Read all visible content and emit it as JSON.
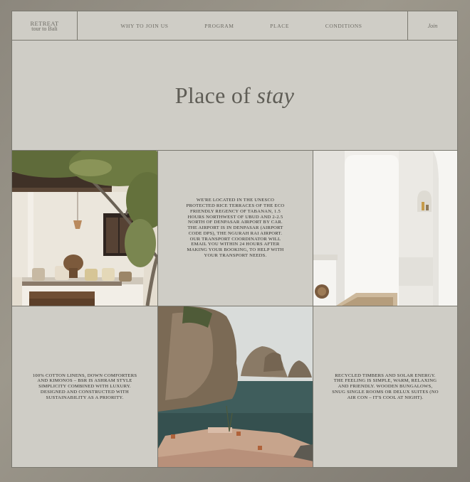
{
  "logo": {
    "line1": "RETREAT",
    "line2": "tour to Bali"
  },
  "nav": {
    "items": [
      {
        "label": "WHY TO JOIN US"
      },
      {
        "label": "PROGRAM"
      },
      {
        "label": "PLACE"
      },
      {
        "label": "CONDITIONS"
      }
    ],
    "join_label": "Join"
  },
  "hero": {
    "title_part1": "Place of ",
    "title_part2": "stay"
  },
  "sections": {
    "location_text": "WE'RE LOCATED IN THE UNESCO PROTECTED RICE TERRACES OF THE ECO FRIENDLY REGENCY OF TABANAN, 1.5 HOURS NORTHWEST OF UBUD AND 2-2.5 NORTH OF DENPASAR AIRPORT BY CAR. THE AIRPORT IS IN DENPASAR (AIRPORT CODE DPS), THE NGURAH RAI AIRPORT. OUR TRANSPORT COORDINATOR WILL EMAIL YOU WITHIN 24 HOURS AFTER MAKING YOUR BOOKING, TO HELP WITH YOUR TRANSPORT NEEDS.",
    "linens_text": "100% COTTON LINENS, DOWN COMFORTERS AND KIMONOS – BSR IS ASHRAM STYLE SIMPLICITY COMBINED WITH LUXURY. DESIGNED AND CONSTRUCTED WITH SUSTAINABILITY AS A PRIORITY.",
    "materials_text": "RECYCLED TIMBERS AND SOLAR ENERGY. THE FEELING IS SIMPLE, WARM, RELAXING AND FRIENDLY. WOODEN BUNGALOWS, SNUG SINGLE ROOMS OR DELUX SUITES (NO AIR CON – IT'S COOL AT NIGHT)."
  },
  "colors": {
    "panel": "#cfcdc6",
    "border": "#7a786f",
    "text_muted": "#6c6a63",
    "text_dark": "#2e2d2a"
  }
}
